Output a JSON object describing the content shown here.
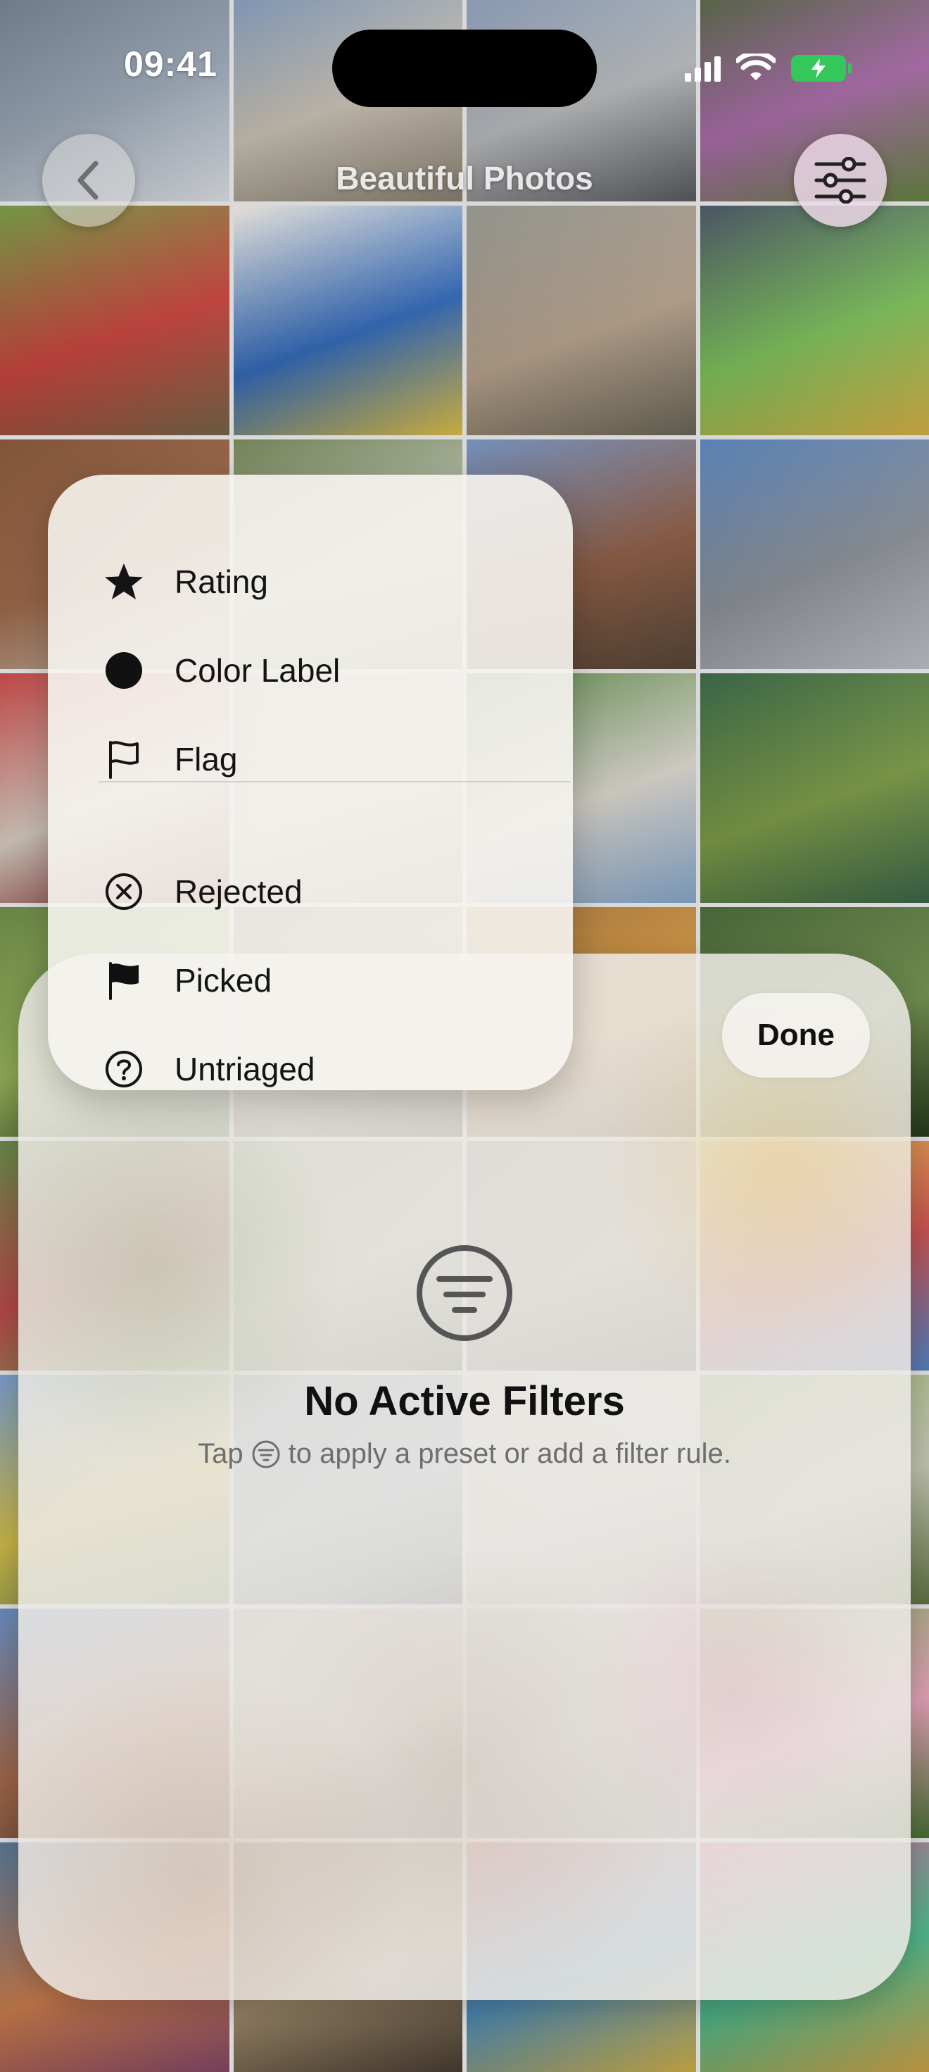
{
  "status_bar": {
    "time": "09:41"
  },
  "nav": {
    "title": "Beautiful Photos",
    "back_icon": "chevron-left-icon",
    "filter_icon": "sliders-icon"
  },
  "grid": {
    "tiles": [
      {
        "name": "photo-snowy-mountains",
        "colors": [
          "#5f6c7d",
          "#9aa6b5",
          "#e8ecf1"
        ]
      },
      {
        "name": "photo-liverpool-building",
        "colors": [
          "#6b89b1",
          "#c9c1b3",
          "#8e8676"
        ]
      },
      {
        "name": "photo-city-street",
        "colors": [
          "#7a8fae",
          "#b7b9bb",
          "#5d5f64"
        ]
      },
      {
        "name": "photo-purple-flowers",
        "colors": [
          "#3d5a2b",
          "#a86aa8",
          "#6a8a45"
        ]
      },
      {
        "name": "photo-tulip-field",
        "colors": [
          "#6a8f3a",
          "#c8423b",
          "#7b6a4b"
        ]
      },
      {
        "name": "photo-toy-and-package",
        "colors": [
          "#e1ddd6",
          "#2f67b7",
          "#e8c84a"
        ]
      },
      {
        "name": "photo-bare-trees",
        "colors": [
          "#8b8d86",
          "#b6a18b",
          "#6e6a5a"
        ]
      },
      {
        "name": "photo-fruit-bowl",
        "colors": [
          "#3f4a5a",
          "#7cc05a",
          "#e1b94a"
        ]
      },
      {
        "name": "photo-bread",
        "colors": [
          "#7a4a2c",
          "#a0694a",
          "#dcd1c2"
        ]
      },
      {
        "name": "photo-garden",
        "colors": [
          "#6a7b4d",
          "#c1c7b8",
          "#9bb07a"
        ]
      },
      {
        "name": "photo-canyon-river",
        "colors": [
          "#6b88b5",
          "#8b5a42",
          "#5b4a3a"
        ]
      },
      {
        "name": "photo-city-skyline",
        "colors": [
          "#4f79b0",
          "#8a8f96",
          "#c8ccd2"
        ]
      },
      {
        "name": "photo-bookshelf",
        "colors": [
          "#b93b3b",
          "#d9cfc2",
          "#8c2c2c"
        ]
      },
      {
        "name": "photo-blurred-room",
        "colors": [
          "#bdb6ac",
          "#d8d2ca",
          "#a79f93"
        ]
      },
      {
        "name": "photo-pagoda",
        "colors": [
          "#4f7b3c",
          "#d9d4cb",
          "#8db0d6"
        ]
      },
      {
        "name": "photo-graduation",
        "colors": [
          "#2d5a3a",
          "#7a9a45",
          "#3f6a4c"
        ]
      },
      {
        "name": "photo-lawn",
        "colors": [
          "#5f7d3a",
          "#9ab85c",
          "#495f31"
        ]
      },
      {
        "name": "photo-market",
        "colors": [
          "#6a6050",
          "#b39b7a",
          "#4d4539"
        ]
      },
      {
        "name": "photo-orange-lights",
        "colors": [
          "#9b6a2f",
          "#d89a42",
          "#4d3a25"
        ]
      },
      {
        "name": "photo-forest",
        "colors": [
          "#3c5b2d",
          "#6e8d4a",
          "#2a3f20"
        ]
      },
      {
        "name": "photo-flower-beds",
        "colors": [
          "#5a7d3b",
          "#c04a4a",
          "#96b167"
        ]
      },
      {
        "name": "photo-park-path",
        "colors": [
          "#7e8f62",
          "#b8b49e",
          "#56683f"
        ]
      },
      {
        "name": "photo-stone-wall",
        "colors": [
          "#8c8378",
          "#b5aca0",
          "#6a6258"
        ]
      },
      {
        "name": "photo-colorful-toys",
        "colors": [
          "#d4b23a",
          "#c94d4d",
          "#5c8dd1"
        ]
      },
      {
        "name": "photo-yellow-statue",
        "colors": [
          "#6a8fc0",
          "#d8c24a",
          "#7b9a5d"
        ]
      },
      {
        "name": "photo-round-object",
        "colors": [
          "#7a8a9a",
          "#a3b1c0",
          "#5c6a78"
        ]
      },
      {
        "name": "photo-bright-scene",
        "colors": [
          "#d6d2c8",
          "#e8e4dc",
          "#b7b1a5"
        ]
      },
      {
        "name": "photo-hills",
        "colors": [
          "#8ba05f",
          "#c4c6b2",
          "#6a7c47"
        ]
      },
      {
        "name": "photo-brick-building",
        "colors": [
          "#5a80b4",
          "#a86a4c",
          "#7b5a43"
        ]
      },
      {
        "name": "photo-courtyard",
        "colors": [
          "#9c9284",
          "#c7bfb2",
          "#7a7063"
        ]
      },
      {
        "name": "photo-grey-scene",
        "colors": [
          "#a9a49a",
          "#c9c5bc",
          "#8a857c"
        ]
      },
      {
        "name": "photo-pink-blossoms",
        "colors": [
          "#6a9a4a",
          "#e6a0b8",
          "#4d7a36"
        ]
      },
      {
        "name": "photo-street-art",
        "colors": [
          "#4a6a8a",
          "#c97a4a",
          "#8a4a6a"
        ]
      },
      {
        "name": "photo-crowd",
        "colors": [
          "#6a5a4a",
          "#a08a6a",
          "#4a3f33"
        ]
      },
      {
        "name": "photo-murals",
        "colors": [
          "#b84a4a",
          "#4a8ab8",
          "#d8b84a"
        ]
      },
      {
        "name": "photo-colorful-wall",
        "colors": [
          "#c94a8a",
          "#4ab88a",
          "#d8a84a"
        ]
      }
    ]
  },
  "menu": {
    "items": [
      {
        "label": "Rating",
        "icon": "star-icon"
      },
      {
        "label": "Color Label",
        "icon": "filled-circle-icon"
      },
      {
        "label": "Flag",
        "icon": "flag-outline-icon"
      },
      {
        "label": "Rejected",
        "icon": "x-circle-icon"
      },
      {
        "label": "Picked",
        "icon": "flag-filled-icon"
      },
      {
        "label": "Untriaged",
        "icon": "question-circle-icon"
      }
    ]
  },
  "sheet": {
    "done_label": "Done",
    "empty_icon": "filter-circle-icon",
    "empty_title": "No Active Filters",
    "empty_sub_before": "Tap",
    "empty_sub_after": "to apply a preset or add a filter rule."
  },
  "colors": {
    "battery": "#34c759",
    "text": "#111111",
    "subtext": "#6e6e6e"
  }
}
